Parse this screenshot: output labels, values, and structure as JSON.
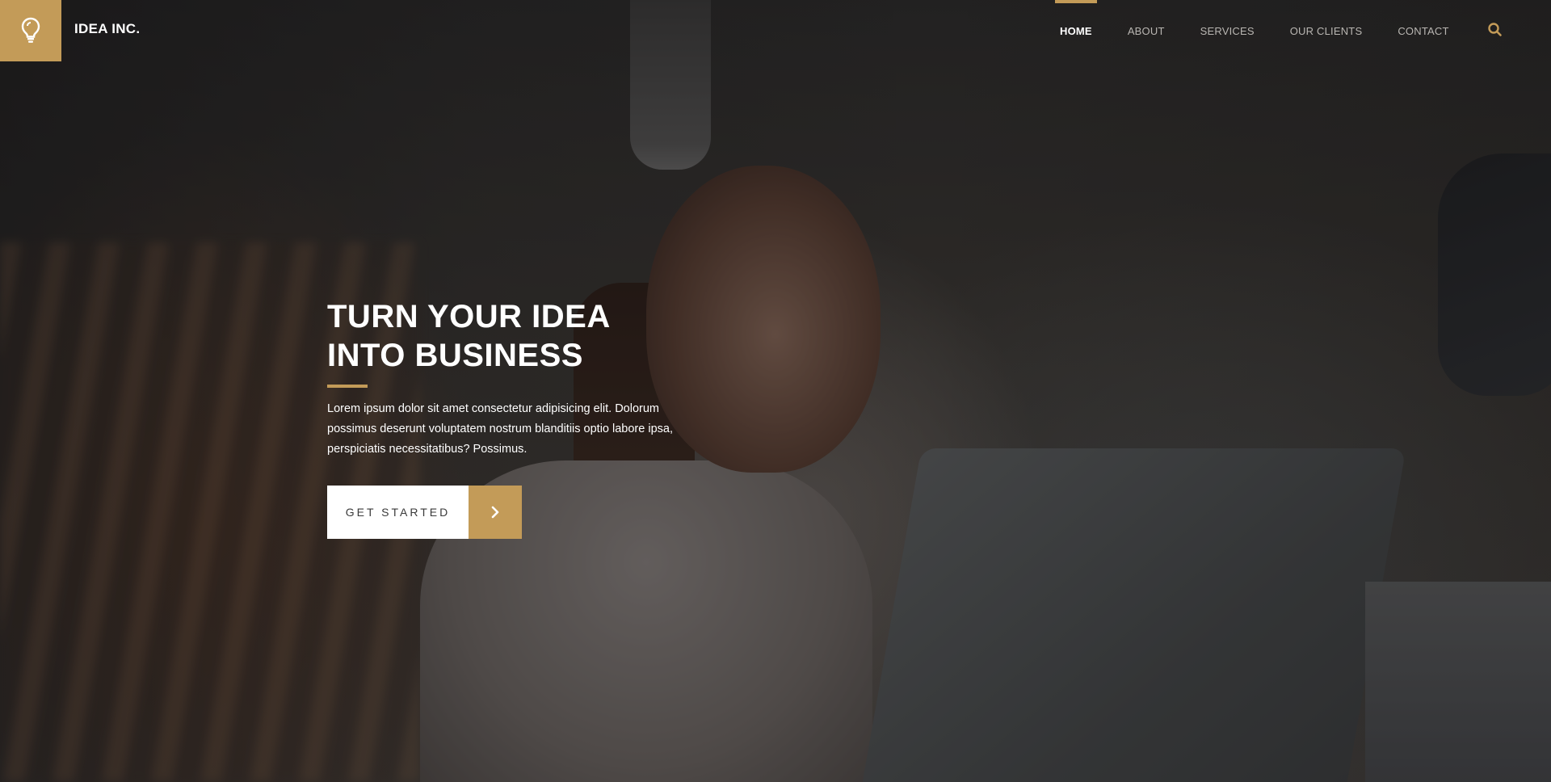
{
  "brand": {
    "name": "IDEA INC.",
    "logo_icon": "lightbulb-icon",
    "accent_color": "#c39b58"
  },
  "nav": {
    "items": [
      {
        "label": "HOME",
        "active": true
      },
      {
        "label": "ABOUT",
        "active": false
      },
      {
        "label": "SERVICES",
        "active": false
      },
      {
        "label": "OUR CLIENTS",
        "active": false
      },
      {
        "label": "CONTACT",
        "active": false
      }
    ],
    "search_icon": "search-icon"
  },
  "hero": {
    "title_line1": "TURN YOUR IDEA",
    "title_line2": "INTO BUSINESS",
    "text": "Lorem ipsum dolor sit amet consectetur adipisicing elit. Dolorum possimus deserunt voluptatem nostrum blanditiis optio labore ipsa, perspiciatis necessitatibus? Possimus.",
    "cta_label": "GET STARTED",
    "cta_icon": "chevron-right-icon"
  }
}
